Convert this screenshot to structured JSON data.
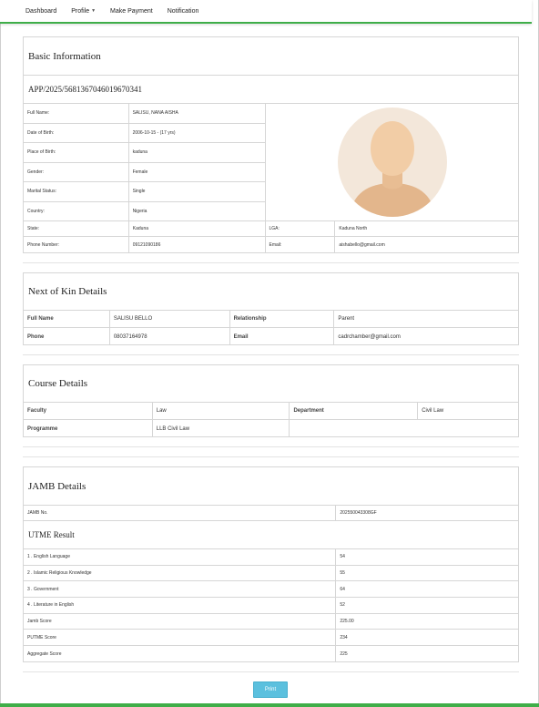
{
  "nav": {
    "items": [
      "Dashboard",
      "Profile",
      "Make Payment",
      "Notification"
    ]
  },
  "basic": {
    "title": "Basic Information",
    "app_no": "APP/2025/5681367046019670341",
    "full_name_label": "Full Name:",
    "full_name": "SALISU, NANA AISHA",
    "dob_label": "Date of Birth:",
    "dob": "2006-10-15 - (17 yrs)",
    "pob_label": "Place of Birth:",
    "pob": "kaduna",
    "gender_label": "Gender:",
    "gender": "Female",
    "marital_label": "Marital Status:",
    "marital": "Single",
    "country_label": "Country:",
    "country": "Nigeria",
    "state_label": "State:",
    "state": "Kaduna",
    "lga_label": "LGA:",
    "lga": "Kaduna North",
    "phone_label": "Phone Number:",
    "phone": "09121090186",
    "email_label": "Email:",
    "email": "aishabello@gmail.com"
  },
  "kin": {
    "title": "Next of Kin Details",
    "full_name_label": "Full Name",
    "full_name": "SALISU BELLO",
    "relationship_label": "Relationship",
    "relationship": "Parent",
    "phone_label": "Phone",
    "phone": "08037164978",
    "email_label": "Email",
    "email": "cadrchamber@gmail.com"
  },
  "course": {
    "title": "Course Details",
    "faculty_label": "Faculty",
    "faculty": "Law",
    "department_label": "Department",
    "department": "Civil Law",
    "programme_label": "Programme",
    "programme": "LLB Civil Law"
  },
  "jamb": {
    "title": "JAMB Details",
    "jamb_no_label": "JAMB No.",
    "jamb_no": "202550043308GF",
    "utme_title": "UTME Result",
    "subjects": [
      {
        "name": "1 . English Language",
        "score": "54"
      },
      {
        "name": "2 . Islamic Religious Knowledge",
        "score": "55"
      },
      {
        "name": "3 . Government",
        "score": "64"
      },
      {
        "name": "4 . Literature in English",
        "score": "52"
      }
    ],
    "jamb_score_label": "Jamb Score",
    "jamb_score": "225.00",
    "putme_label": "PUTME Score",
    "putme": "234",
    "aggregate_label": "Aggregate Score",
    "aggregate": "225"
  },
  "print_label": "Print"
}
